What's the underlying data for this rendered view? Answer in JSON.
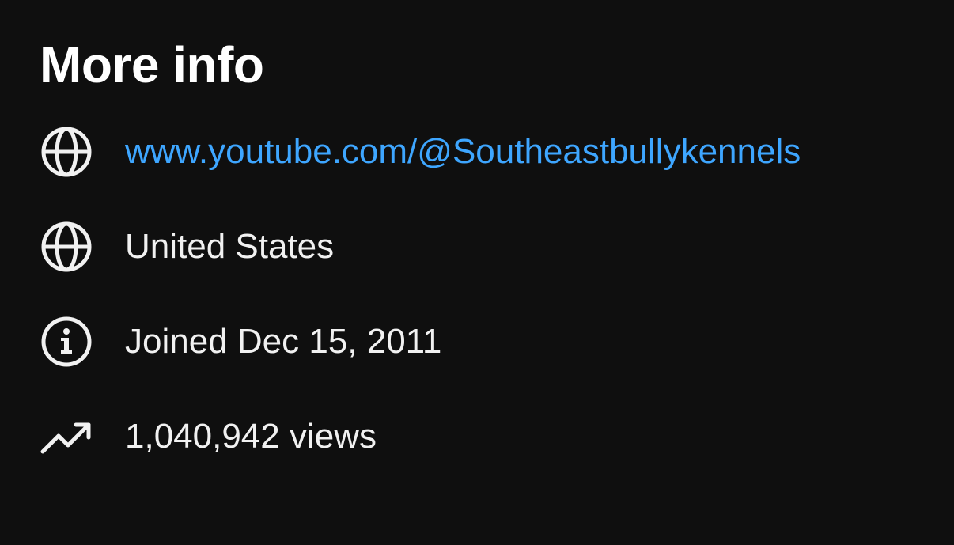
{
  "section": {
    "title": "More info"
  },
  "info_rows": [
    {
      "icon": "globe-icon",
      "text": "www.youtube.com/@Southeastbullykennels",
      "is_link": true
    },
    {
      "icon": "globe-icon",
      "text": "United States",
      "is_link": false
    },
    {
      "icon": "info-icon",
      "text": "Joined Dec 15, 2011",
      "is_link": false
    },
    {
      "icon": "trending-up-icon",
      "text": "1,040,942 views",
      "is_link": false
    }
  ],
  "colors": {
    "background": "#0f0f0f",
    "text": "#f1f1f1",
    "link": "#3ea6ff"
  }
}
